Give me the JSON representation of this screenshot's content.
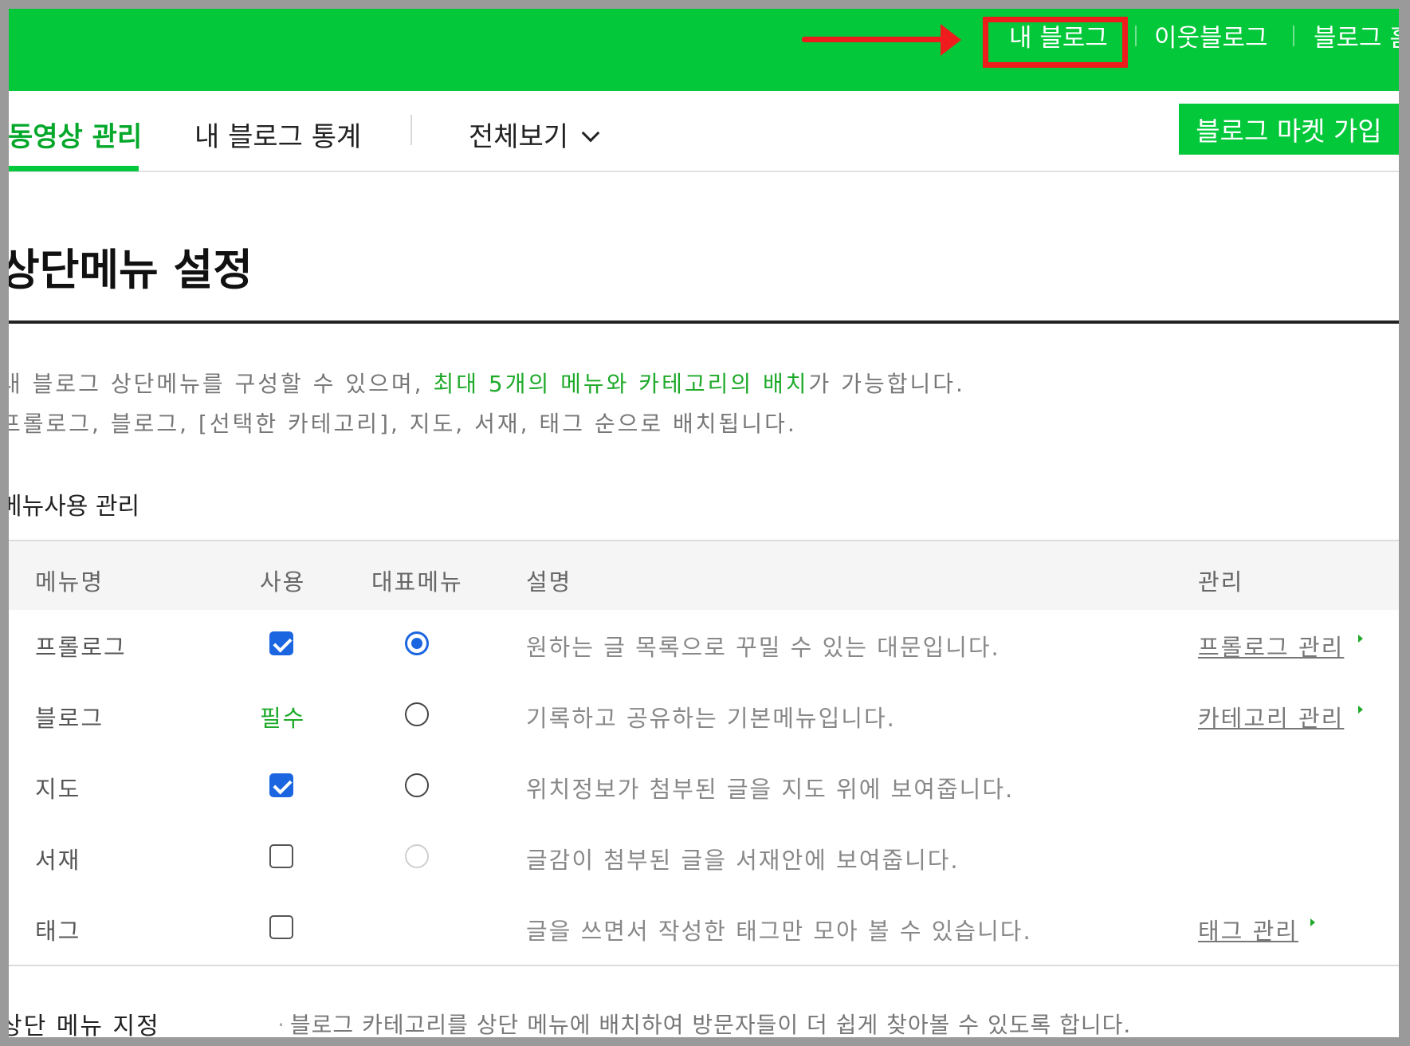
{
  "topbar": {
    "my_blog": "내 블로그",
    "neighbor_blog": "이웃블로그",
    "blog_home_partial": "블로그 홈",
    "accent_color": "#03c83a",
    "annotation_color": "#ee1c1c"
  },
  "subnav": {
    "video_manage": "동영상 관리",
    "blog_stats": "내 블로그 통계",
    "view_all": "전체보기",
    "market_button": "블로그 마켓 가입"
  },
  "page": {
    "title": "상단메뉴 설정",
    "desc_line1_pre": "내 블로그 상단메뉴를 구성할 수 있으며, ",
    "desc_line1_highlight": "최대 5개의 메뉴와 카테고리의 배치",
    "desc_line1_post": "가 가능합니다.",
    "desc_line2": "프롤로그, 블로그, [선택한 카테고리], 지도, 서재, 태그 순으로 배치됩니다.",
    "section_title": "메뉴사용 관리"
  },
  "table": {
    "headers": {
      "name": "메뉴명",
      "use": "사용",
      "main_menu": "대표메뉴",
      "description": "설명",
      "manage": "관리"
    },
    "rows": [
      {
        "name": "프롤로그",
        "use": "checked",
        "main": "selected",
        "description": "원하는 글 목록으로 꾸밀 수 있는 대문입니다.",
        "manage": "프롤로그 관리"
      },
      {
        "name": "블로그",
        "use": "필수",
        "main": "unselected",
        "description": "기록하고 공유하는 기본메뉴입니다.",
        "manage": "카테고리 관리"
      },
      {
        "name": "지도",
        "use": "checked",
        "main": "unselected",
        "description": "위치정보가 첨부된 글을 지도 위에 보여줍니다.",
        "manage": ""
      },
      {
        "name": "서재",
        "use": "unchecked",
        "main": "disabled",
        "description": "글감이 첨부된 글을 서재안에 보여줍니다.",
        "manage": ""
      },
      {
        "name": "태그",
        "use": "unchecked",
        "main": "none",
        "description": "글을 쓰면서 작성한 태그만 모아 볼 수 있습니다.",
        "manage": "태그 관리"
      }
    ]
  },
  "bottom": {
    "label": "상단 메뉴 지정",
    "note": "블로그 카테고리를 상단 메뉴에 배치하여 방문자들이 더 쉽게 찾아볼 수 있도록 합니다."
  }
}
